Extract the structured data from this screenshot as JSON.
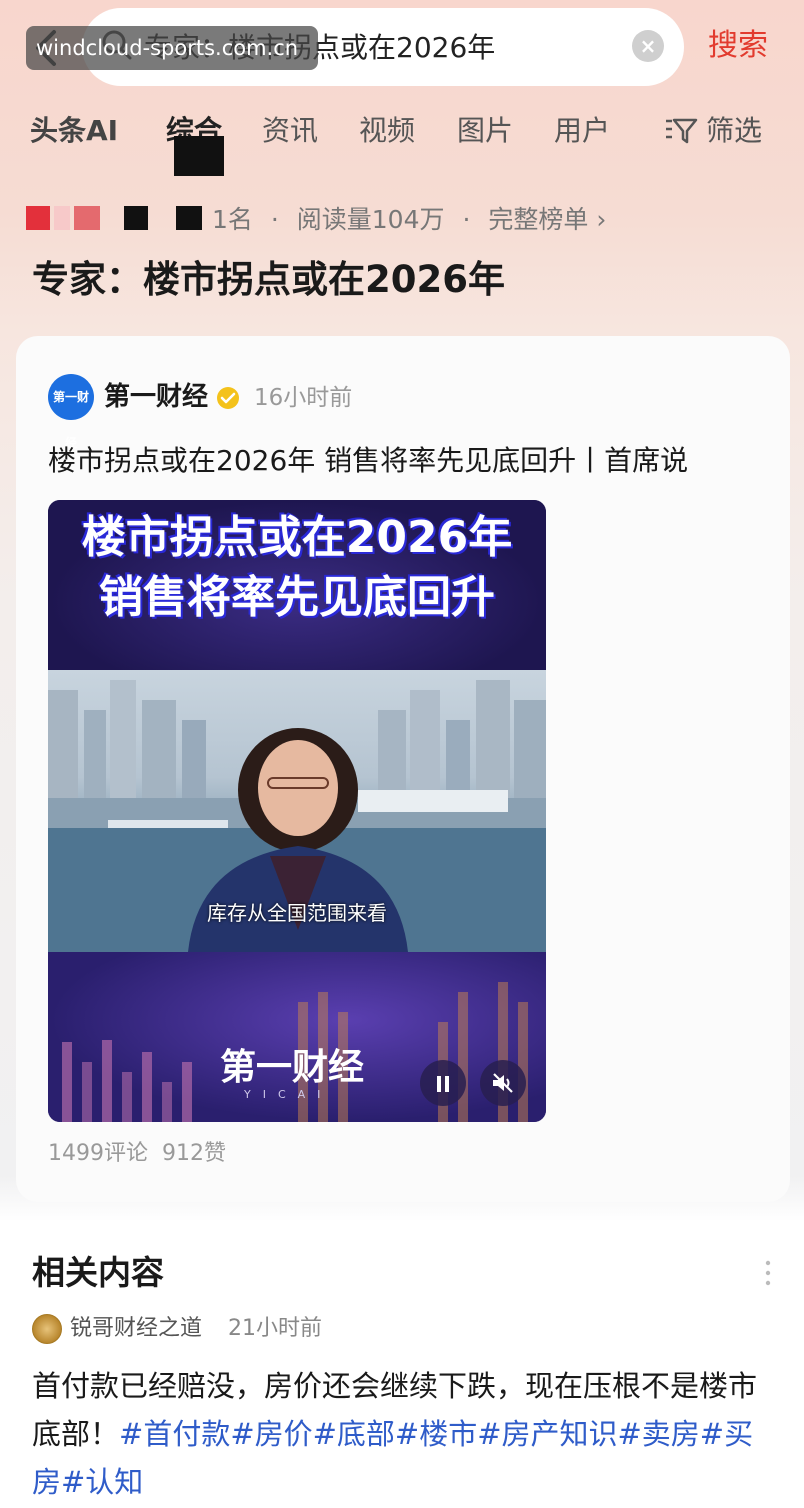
{
  "watermark": "windcloud-sports.com.cn",
  "search": {
    "query": "专家：楼市拐点或在2026年",
    "button_label": "搜索"
  },
  "tabs": [
    {
      "label": "头条AI"
    },
    {
      "label": "综合"
    },
    {
      "label": "资讯"
    },
    {
      "label": "视频"
    },
    {
      "label": "图片"
    },
    {
      "label": "用户"
    }
  ],
  "filter_label": "筛选",
  "rank": {
    "rank_text": "1名",
    "read_count": "阅读量104万",
    "full_list": "完整榜单"
  },
  "page_title": "专家：楼市拐点或在2026年",
  "post": {
    "author": "第一财经",
    "avatar_text": "第一财经",
    "time": "16小时前",
    "title": "楼市拐点或在2026年 销售将率先见底回升丨首席说",
    "video": {
      "headline_1": "楼市拐点或在2026年",
      "headline_2": "销售将率先见底回升",
      "subtitle": "库存从全国范围来看",
      "logo": "第一财经",
      "logo_sub": "YICAI"
    },
    "comments": "1499评论",
    "likes": "912赞"
  },
  "related": {
    "title": "相关内容",
    "author": "锐哥财经之道",
    "time": "21小时前",
    "text": "首付款已经赔没，房价还会继续下跌，现在压根不是楼市底部！",
    "tags": "#首付款#房价#底部#楼市#房产知识#卖房#买房#认知"
  },
  "colors": {
    "accent": "#e23b2e",
    "link": "#2f5cc9",
    "brand_blue": "#1d6fe0"
  }
}
